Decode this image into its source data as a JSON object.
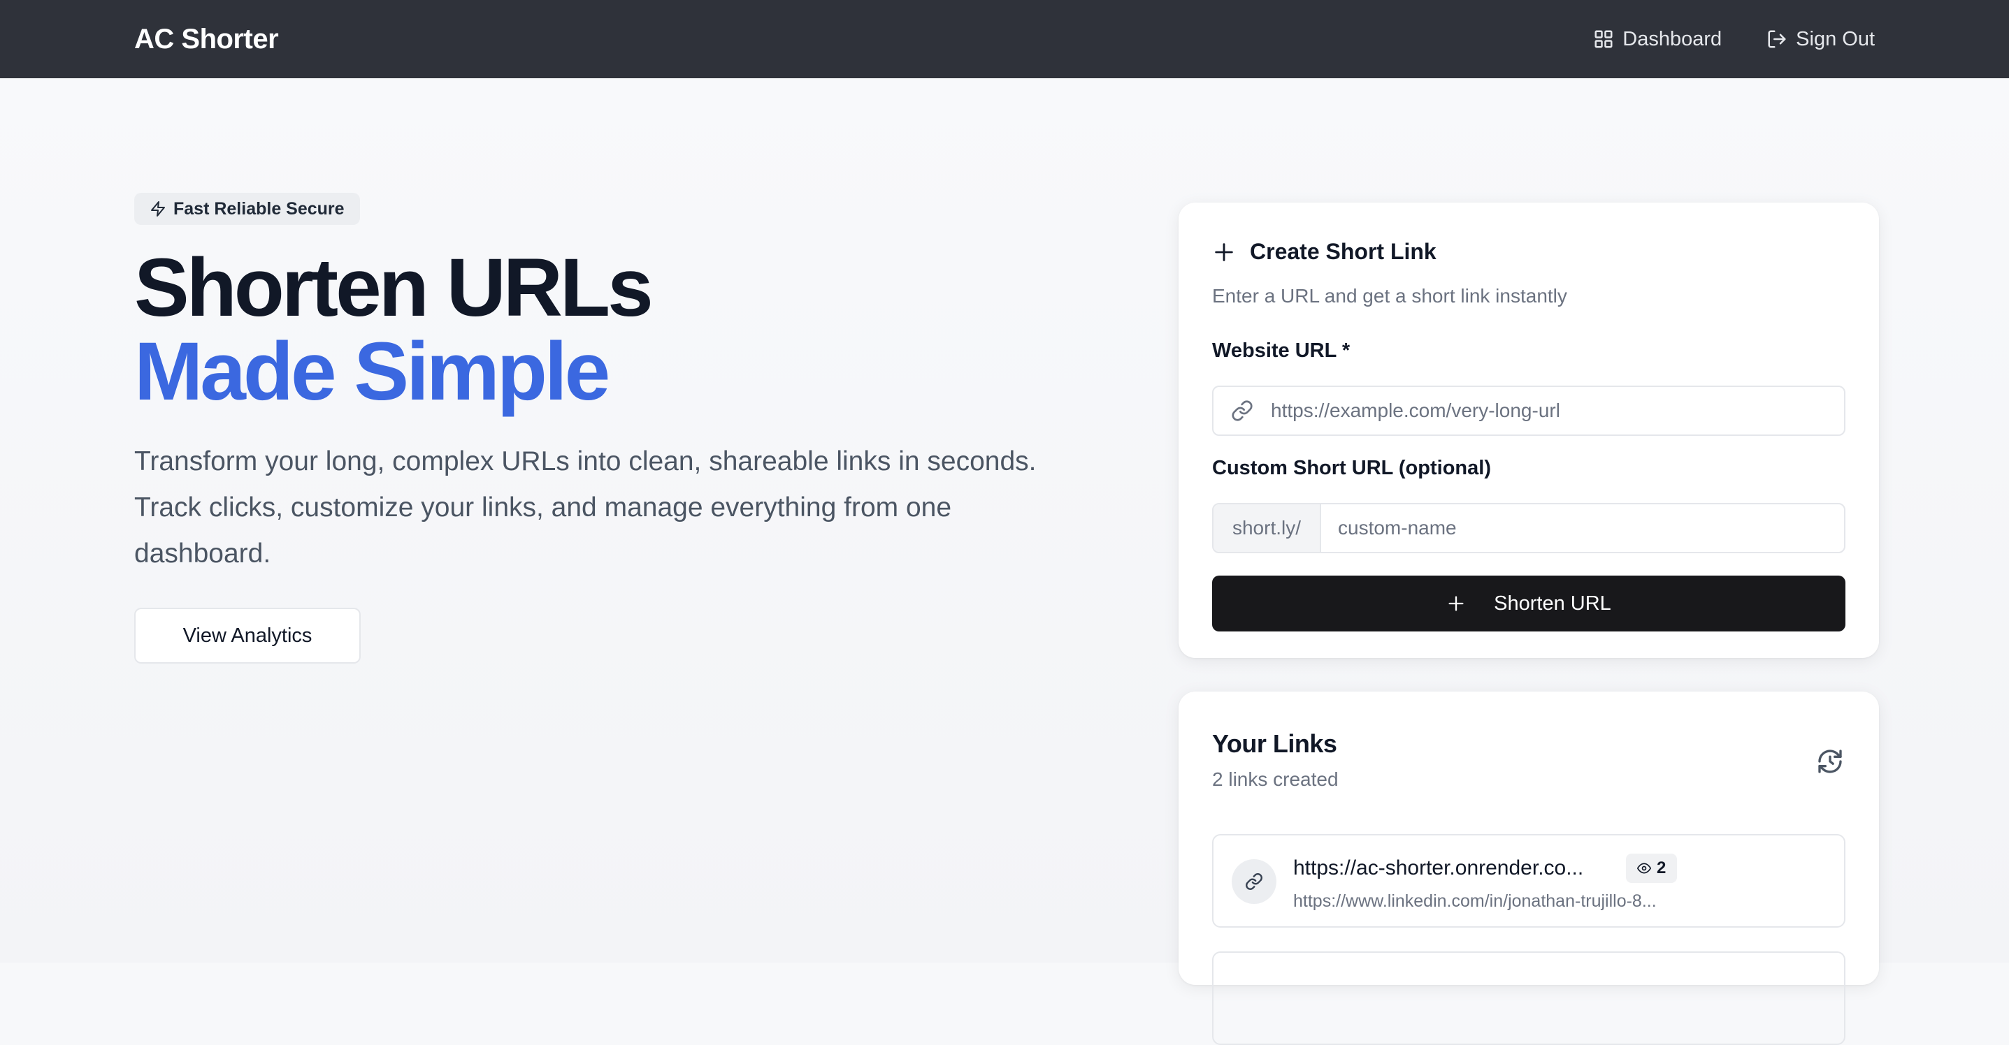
{
  "navbar": {
    "brand": "AC Shorter",
    "links": [
      {
        "label": "Dashboard",
        "icon": "dashboard-grid-icon"
      },
      {
        "label": "Sign Out",
        "icon": "sign-out-icon"
      }
    ],
    "background": "#2f323a"
  },
  "hero": {
    "badge": "Fast Reliable Secure",
    "title_line1": "Shorten URLs",
    "title_line2": "Made Simple",
    "description": "Transform your long, complex URLs into clean, shareable links in seconds. Track clicks, customize your links, and manage everything from one dashboard.",
    "cta_label": "View Analytics",
    "accent_color": "#3b68e0"
  },
  "create_card": {
    "title": "Create Short Link",
    "subtitle": "Enter a URL and get a short link instantly",
    "url_label": "Website URL *",
    "url_placeholder": "https://example.com/very-long-url",
    "url_value": "",
    "custom_label": "Custom Short URL (optional)",
    "custom_prefix": "short.ly/",
    "custom_placeholder": "custom-name",
    "custom_value": "",
    "submit_label": "Shorten URL"
  },
  "links_card": {
    "title": "Your Links",
    "count_text": "2 links created",
    "items": [
      {
        "short_url": "https://ac-shorter.onrender.co...",
        "original_url": "https://www.linkedin.com/in/jonathan-trujillo-8...",
        "clicks": "2"
      }
    ]
  }
}
